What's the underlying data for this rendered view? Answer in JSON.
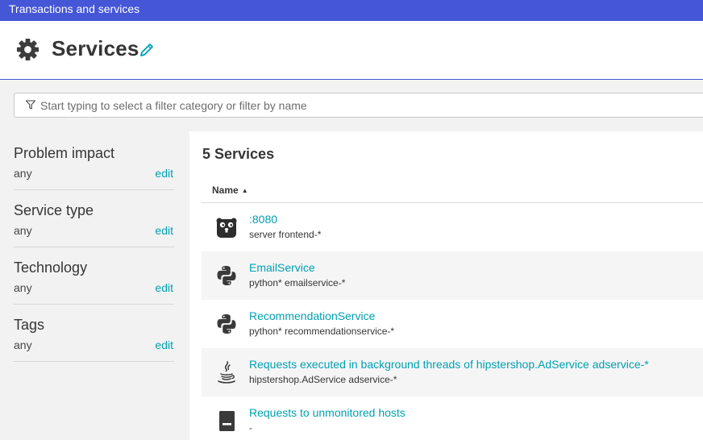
{
  "topbar": {
    "title": "Transactions and services"
  },
  "header": {
    "title": "Services",
    "icon": "gear-icon",
    "edit_icon": "pencil-icon"
  },
  "filter": {
    "placeholder": "Start typing to select a filter category or filter by name",
    "icon": "filter-icon"
  },
  "sidebar": {
    "facets": [
      {
        "title": "Problem impact",
        "value": "any",
        "edit": "edit"
      },
      {
        "title": "Service type",
        "value": "any",
        "edit": "edit"
      },
      {
        "title": "Technology",
        "value": "any",
        "edit": "edit"
      },
      {
        "title": "Tags",
        "value": "any",
        "edit": "edit"
      }
    ]
  },
  "main": {
    "count_title": "5 Services",
    "column_name": "Name",
    "sort_indicator": "▲",
    "services": [
      {
        "name": ":8080",
        "sub": "server frontend-*",
        "icon": "go-gopher-icon"
      },
      {
        "name": "EmailService",
        "sub": "python* emailservice-*",
        "icon": "python-icon"
      },
      {
        "name": "RecommendationService",
        "sub": "python* recommendationservice-*",
        "icon": "python-icon"
      },
      {
        "name": "Requests executed in background threads of hipstershop.AdService adservice-*",
        "sub": "hipstershop.AdService adservice-*",
        "icon": "java-icon"
      },
      {
        "name": "Requests to unmonitored hosts",
        "sub": "-",
        "icon": "server-icon"
      }
    ]
  },
  "colors": {
    "brand": "#4556d7",
    "link": "#00a1b2"
  }
}
